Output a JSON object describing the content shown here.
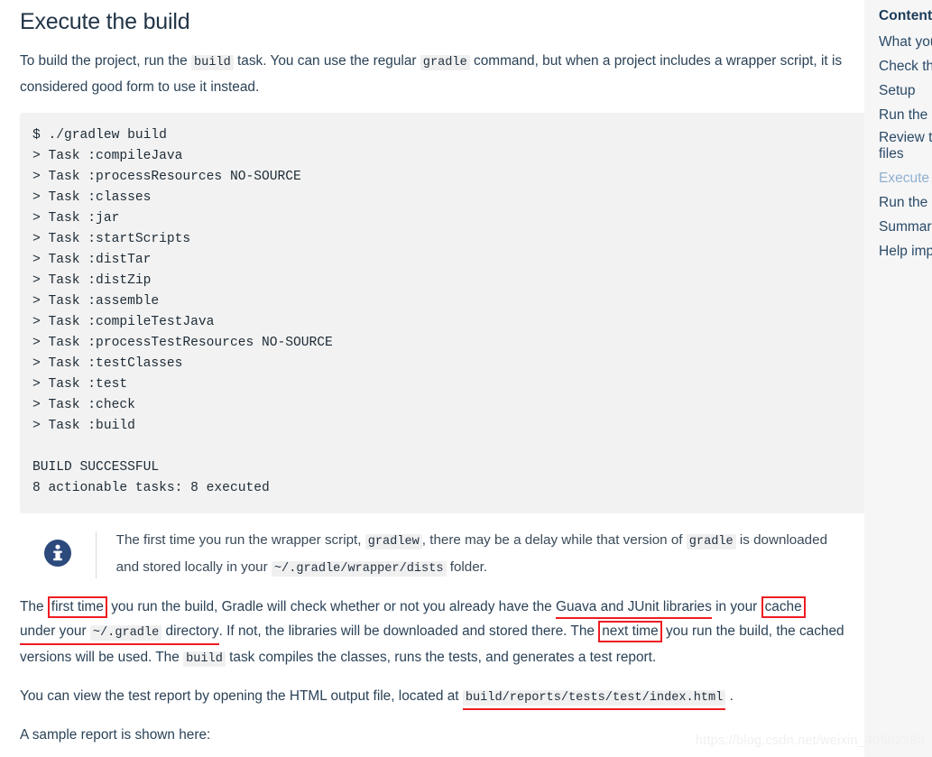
{
  "page_title": "Execute the build",
  "intro": {
    "part1": "To build the project, run the ",
    "code1": "build",
    "part2": " task. You can use the regular ",
    "code2": "gradle",
    "part3": " command, but when a project includes a wrapper script, it is considered good form to use it instead."
  },
  "code_block": {
    "lines": [
      "$ ./gradlew build",
      "> Task :compileJava",
      "> Task :processResources NO-SOURCE",
      "> Task :classes",
      "> Task :jar",
      "> Task :startScripts",
      "> Task :distTar",
      "> Task :distZip",
      "> Task :assemble",
      "> Task :compileTestJava",
      "> Task :processTestResources NO-SOURCE",
      "> Task :testClasses",
      "> Task :test",
      "> Task :check",
      "> Task :build",
      "",
      "BUILD SUCCESSFUL",
      "8 actionable tasks: 8 executed"
    ],
    "text": "$ ./gradlew build\n> Task :compileJava\n> Task :processResources NO-SOURCE\n> Task :classes\n> Task :jar\n> Task :startScripts\n> Task :distTar\n> Task :distZip\n> Task :assemble\n> Task :compileTestJava\n> Task :processTestResources NO-SOURCE\n> Task :testClasses\n> Task :test\n> Task :check\n> Task :build\n\nBUILD SUCCESSFUL\n8 actionable tasks: 8 executed"
  },
  "note": {
    "icon": "info-icon",
    "part1": "The first time you run the wrapper script, ",
    "code1": "gradlew",
    "part2": ", there may be a delay while that version of ",
    "code2": "gradle",
    "part3": " is downloaded and stored locally in your ",
    "code3": "~/.gradle/wrapper/dists",
    "part4": " folder."
  },
  "annotated_paragraph": {
    "p1": "The ",
    "box1": "first time",
    "p2": " you run the build, Gradle will check whether or not you already have the ",
    "ul1": "Guava and JUnit libraries",
    "p3": " in your ",
    "box2": "cache",
    "p4": " ",
    "ul2": "under your ",
    "ul2_code": "~/.gradle",
    "ul2_tail": " directory",
    "p5": ". If not, the libraries will be downloaded and stored there. The ",
    "box3": "next time",
    "p6": " you run the build, the cached versions will be used. The ",
    "code1": "build",
    "p7": " task compiles the classes, runs the tests, and generates a test report."
  },
  "report_paragraph": {
    "part1": "You can view the test report by opening the HTML output file, located at ",
    "code1": "build/reports/tests/test/index.html",
    "part2": " ."
  },
  "sample_paragraph": "A sample report is shown here:",
  "sidebar": {
    "title": "Contents",
    "items": [
      {
        "label": "What you",
        "active": false,
        "wrap": false
      },
      {
        "label": "Check th",
        "active": false,
        "wrap": false
      },
      {
        "label": "Setup",
        "active": false,
        "wrap": false
      },
      {
        "label": "Run the",
        "active": false,
        "wrap": false
      },
      {
        "label": "Review t files",
        "active": false,
        "wrap": true
      },
      {
        "label": "Execute",
        "active": true,
        "wrap": false
      },
      {
        "label": "Run the",
        "active": false,
        "wrap": false
      },
      {
        "label": "Summar",
        "active": false,
        "wrap": false
      },
      {
        "label": "Help imp",
        "active": false,
        "wrap": false
      }
    ]
  },
  "watermark": "https://blog.csdn.net/weixin_40562288",
  "colors": {
    "annotation_red": "#ee1d23",
    "code_bg": "#f2f2f2",
    "sidebar_bg": "#f6f6f7",
    "note_icon": "#2c4a7c",
    "active_link": "#8fb0cf",
    "text": "#2b4257"
  }
}
